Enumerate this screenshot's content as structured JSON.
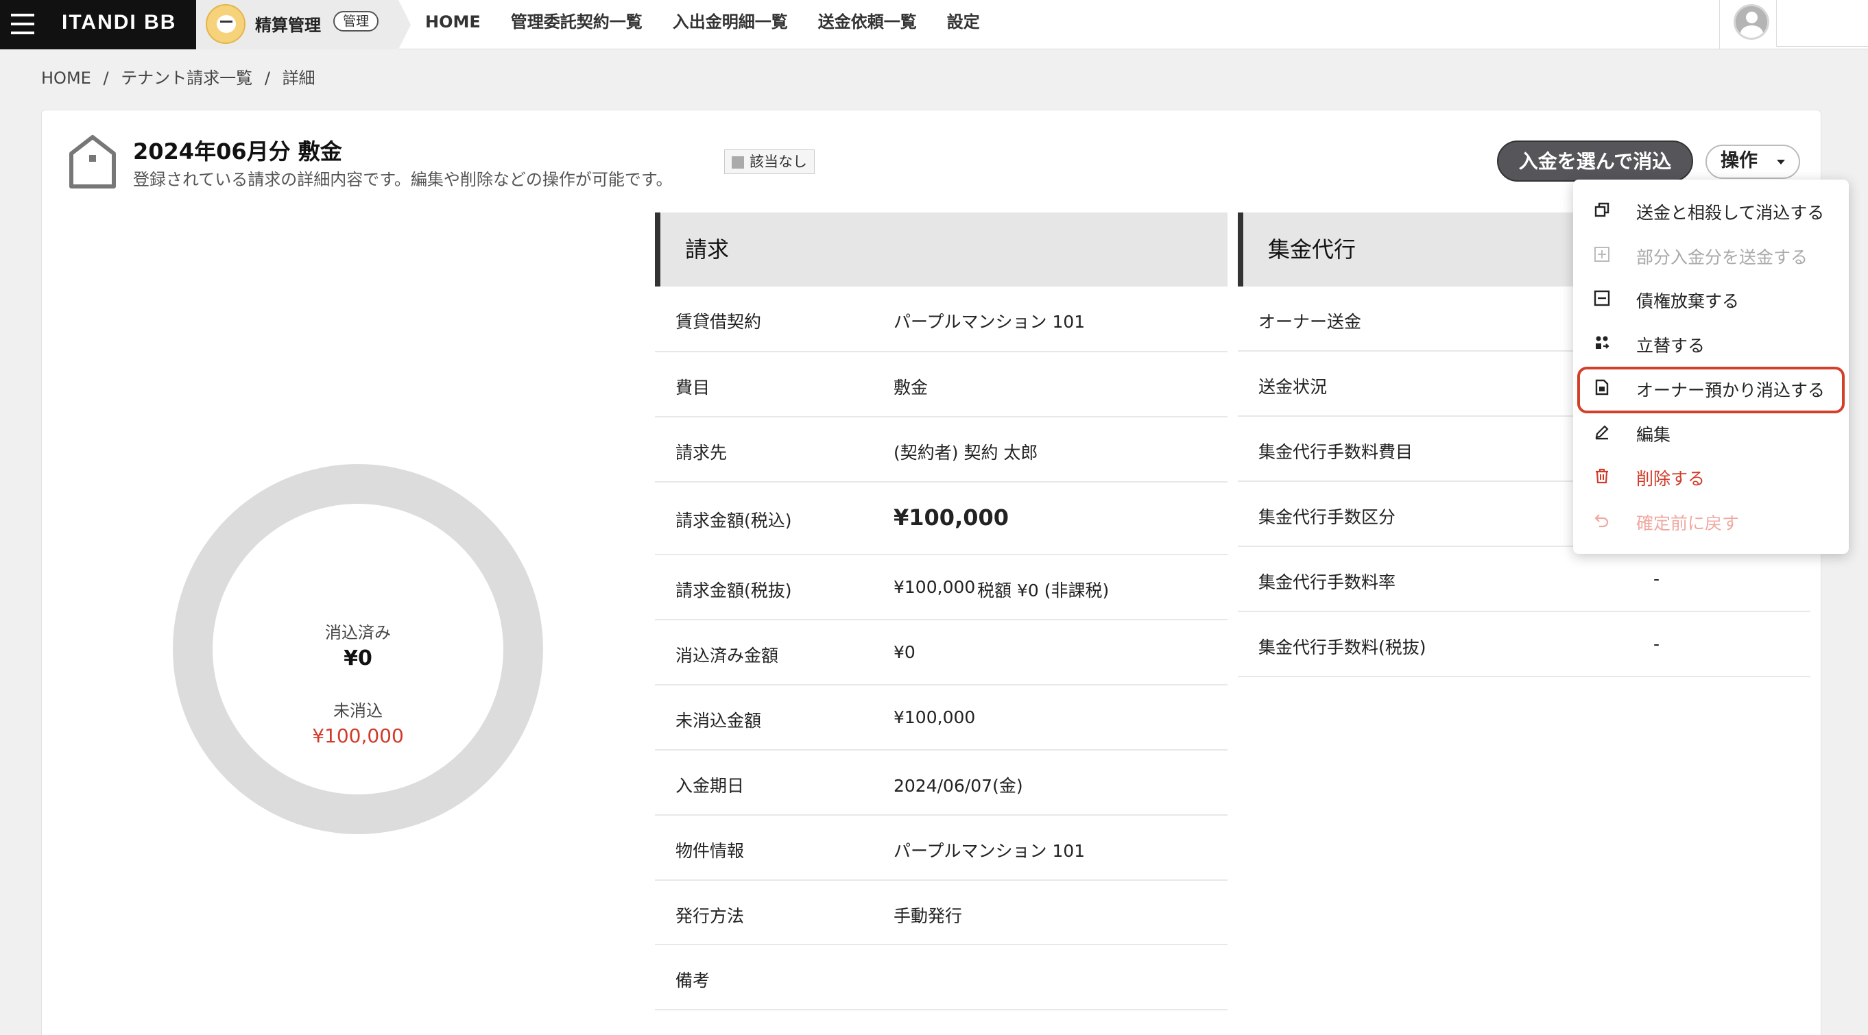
{
  "header": {
    "logo": "ITANDI BB",
    "app_title": "精算管理",
    "app_badge": "管理",
    "nav": [
      "HOME",
      "管理委託契約一覧",
      "入出金明細一覧",
      "送金依頼一覧",
      "設定"
    ]
  },
  "breadcrumb": [
    "HOME",
    "/",
    "テナント請求一覧",
    "/",
    "詳細"
  ],
  "page": {
    "title": "2024年06月分 敷金",
    "subtitle": "登録されている請求の詳細内容です。編集や削除などの操作が可能です。",
    "tag": "該当なし",
    "primary_button": "入金を選んで消込",
    "ops_button": "操作"
  },
  "donut": {
    "cleared_label": "消込済み",
    "cleared_value": "¥0",
    "uncleared_label": "未消込",
    "uncleared_value": "¥100,000"
  },
  "billing": {
    "heading": "請求",
    "rows": [
      {
        "key": "賃貸借契約",
        "value": "パープルマンション 101"
      },
      {
        "key": "費目",
        "value": "敷金"
      },
      {
        "key": "請求先",
        "value": "(契約者) 契約 太郎"
      },
      {
        "key": "請求金額(税込)",
        "value": "¥100,000"
      },
      {
        "key": "請求金額(税抜)",
        "value": "¥100,000",
        "extra": "税額 ¥0 (非課税)"
      },
      {
        "key": "消込済み金額",
        "value": "¥0"
      },
      {
        "key": "未消込金額",
        "value": "¥100,000"
      },
      {
        "key": "入金期日",
        "value": "2024/06/07(金)"
      },
      {
        "key": "物件情報",
        "value": "パープルマンション 101"
      },
      {
        "key": "発行方法",
        "value": "手動発行"
      },
      {
        "key": "備考",
        "value": ""
      }
    ]
  },
  "collection": {
    "heading": "集金代行",
    "rows": [
      {
        "key": "オーナー送金",
        "value": ""
      },
      {
        "key": "送金状況",
        "value": ""
      },
      {
        "key": "集金代行手数料費目",
        "value": ""
      },
      {
        "key": "集金代行手数区分",
        "value": ""
      },
      {
        "key": "集金代行手数料率",
        "value": "-"
      },
      {
        "key": "集金代行手数料(税抜)",
        "value": "-"
      }
    ]
  },
  "menu": {
    "items": [
      {
        "label": "送金と相殺して消込する",
        "icon": "offset-icon"
      },
      {
        "label": "部分入金分を送金する",
        "icon": "plus-box-icon"
      },
      {
        "label": "債権放棄する",
        "icon": "minus-box-icon"
      },
      {
        "label": "立替する",
        "icon": "advance-icon"
      },
      {
        "label": "オーナー預かり消込する",
        "icon": "deposit-doc-icon"
      },
      {
        "label": "編集",
        "icon": "pencil-icon"
      },
      {
        "label": "削除する",
        "icon": "trash-icon"
      },
      {
        "label": "確定前に戻す",
        "icon": "undo-icon"
      }
    ]
  }
}
